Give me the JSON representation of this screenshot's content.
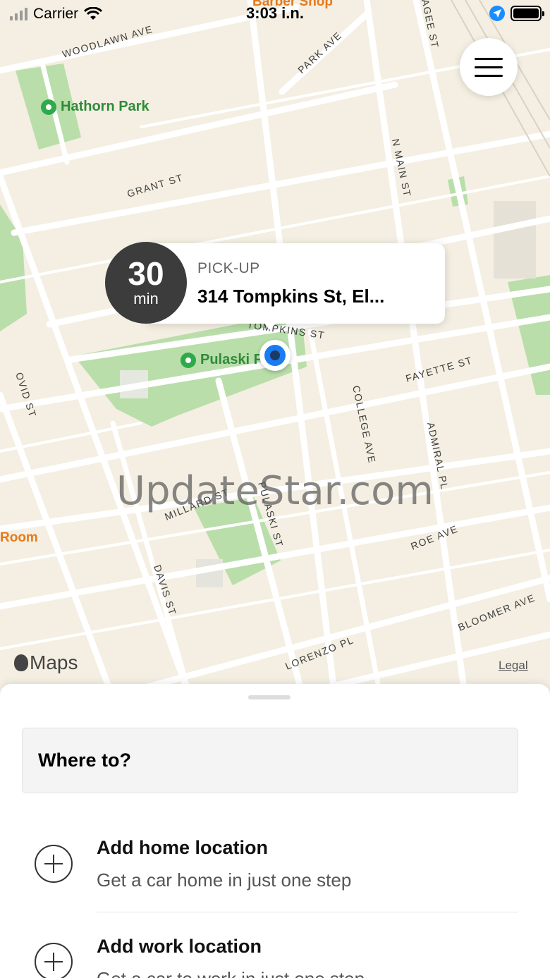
{
  "status_bar": {
    "carrier": "Carrier",
    "time": "3:03 i.n."
  },
  "map": {
    "street_labels": {
      "woodlawn": "WOODLAWN AVE",
      "park": "PARK AVE",
      "grant": "GRANT ST",
      "n_main": "N MAIN ST",
      "tompkins": "TOMPKINS ST",
      "fayette": "FAYETTE ST",
      "ovid": "OVID ST",
      "college": "COLLEGE AVE",
      "admiral": "ADMIRAL PL",
      "millard": "MILLARD ST",
      "pulaski": "PULASKI ST",
      "roe": "ROE AVE",
      "davis": "DAVIS ST",
      "bloomer": "BLOOMER AVE",
      "lorenzo": "LORENZO PL",
      "top_right": "AGEE ST"
    },
    "parks": {
      "hathorn": "Hathorn Park",
      "pulaski": "Pulaski P"
    },
    "poi": {
      "barber": "Barber Shop",
      "room": "Room"
    },
    "watermark": "UpdateStar.com",
    "maps_brand": "Maps",
    "legal": "Legal"
  },
  "pickup": {
    "eta_value": "30",
    "eta_unit": "min",
    "label": "PICK-UP",
    "address": "314 Tompkins St, El..."
  },
  "sheet": {
    "search_placeholder": "Where to?",
    "locations": [
      {
        "title": "Add home location",
        "subtitle": "Get a car home in just one step"
      },
      {
        "title": "Add work location",
        "subtitle": "Get a car to work in just one step"
      }
    ]
  },
  "colors": {
    "map_background": "#f4efe2",
    "park_green": "#b9deaa",
    "road": "#ffffff",
    "accent_blue": "#1a7cf0"
  }
}
